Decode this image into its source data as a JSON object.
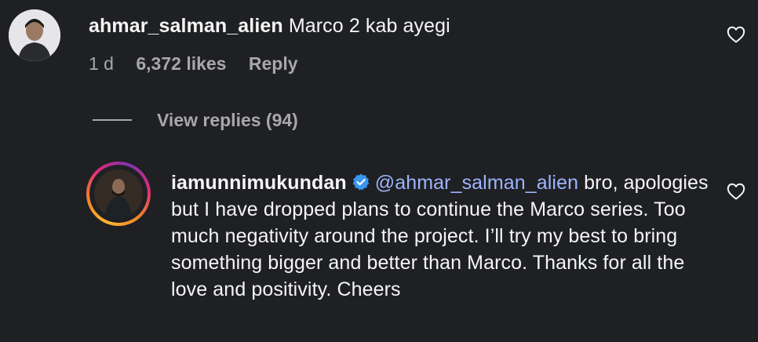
{
  "comments": [
    {
      "username": "ahmar_salman_alien",
      "text": "Marco 2 kab ayegi",
      "time": "1 d",
      "likes": "6,372 likes",
      "reply_label": "Reply"
    },
    {
      "username": "iamunnimukundan",
      "verified": true,
      "mention": "@ahmar_salman_alien",
      "text": " bro, apologies but I have dropped plans to continue the Marco series. Too much negativity around the project. I’ll try my best to bring something bigger and better than Marco. Thanks for all the love and positivity. Cheers"
    }
  ],
  "view_replies_label": "View replies (94)",
  "icons": {
    "like": "heart-outline-icon",
    "verified": "verified-badge-icon"
  },
  "colors": {
    "background": "#1f2023",
    "text": "#f5f5f5",
    "secondary_text": "#a8a8a8",
    "mention": "#9db4ff",
    "verified": "#3897f0"
  }
}
